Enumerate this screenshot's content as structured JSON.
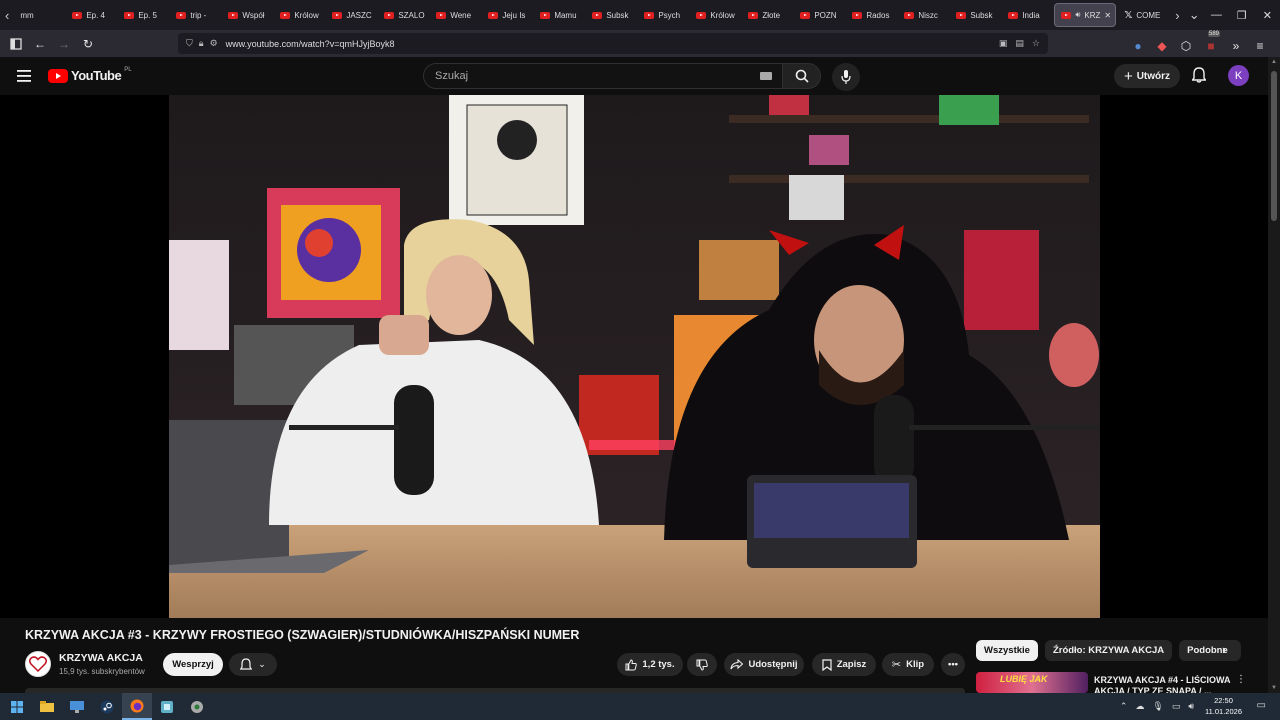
{
  "browser": {
    "tabs": [
      {
        "label": "mm",
        "type": "plain"
      },
      {
        "label": "Ep. 4",
        "type": "yt"
      },
      {
        "label": "Ep. 5",
        "type": "yt"
      },
      {
        "label": "trip -",
        "type": "yt"
      },
      {
        "label": "Współ",
        "type": "yt"
      },
      {
        "label": "Królow",
        "type": "yt"
      },
      {
        "label": "JASZC",
        "type": "yt"
      },
      {
        "label": "SZALO",
        "type": "yt"
      },
      {
        "label": "Wene",
        "type": "yt"
      },
      {
        "label": "Jeju Is",
        "type": "yt"
      },
      {
        "label": "Mamu",
        "type": "yt"
      },
      {
        "label": "Subsk",
        "type": "yt"
      },
      {
        "label": "Psych",
        "type": "yt"
      },
      {
        "label": "Królow",
        "type": "yt"
      },
      {
        "label": "Złote",
        "type": "yt"
      },
      {
        "label": "POZN",
        "type": "yt"
      },
      {
        "label": "Rados",
        "type": "yt"
      },
      {
        "label": "Niszc",
        "type": "yt"
      },
      {
        "label": "Subsk",
        "type": "yt"
      },
      {
        "label": "India",
        "type": "yt"
      },
      {
        "label": "KRZ",
        "type": "active"
      },
      {
        "label": "COME",
        "type": "x"
      }
    ],
    "url": "www.youtube.com/watch?v=qmHJyjBoyk8",
    "extension_badge": "589"
  },
  "youtube": {
    "logo": "YouTube",
    "region": "PL",
    "search_placeholder": "Szukaj",
    "create_label": "Utwórz",
    "avatar_letter": "K"
  },
  "video": {
    "title": "KRZYWA AKCJA #3 - KRZYWY FROSTIEGO (SZWAGIER)/STUDNIÓWKA/HISZPAŃSKI NUMER",
    "channel_name": "KRZYWA AKCJA",
    "subscribers": "15,9 tys. subskrybentów",
    "support_label": "Wesprzyj",
    "likes": "1,2 tys.",
    "share_label": "Udostępnij",
    "save_label": "Zapisz",
    "clip_label": "Klip"
  },
  "sidebar": {
    "chips": [
      "Wszystkie",
      "Źródło: KRZYWA AKCJA",
      "Podobne"
    ],
    "rec_title": "KRZYWA AKCJA #4 - LIŚCIOWA AKCJA / TYP ZE SNAPA / ...",
    "rec_thumb_text": "LUBIĘ JAK"
  },
  "taskbar": {
    "time": "22:50",
    "date": "11.01.2026"
  },
  "colors": {
    "yt_red": "#ff0000",
    "bg": "#0f0f0f",
    "avatar": "#7b3fbf"
  }
}
